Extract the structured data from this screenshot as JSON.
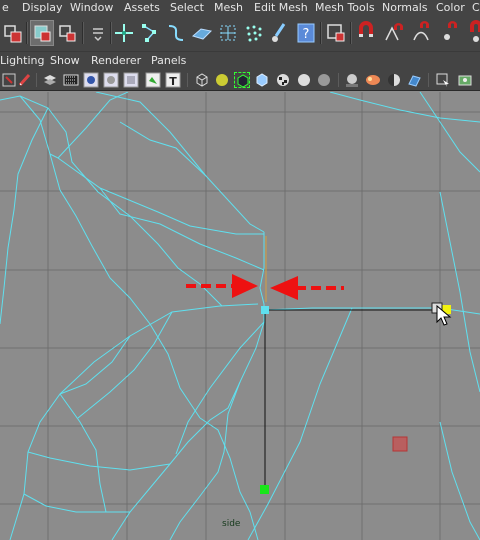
{
  "menubar": {
    "items": [
      "e",
      "Display",
      "Window",
      "Assets",
      "Select",
      "Mesh",
      "Edit Mesh",
      "Mesh Tools",
      "Normals",
      "Color",
      "C"
    ]
  },
  "shelf": {
    "icons": [
      "select-tool-icon",
      "lasso-tool-icon",
      "paint-select-icon",
      "hypershade-icon",
      "move-tool-icon",
      "vertex-select-icon",
      "curve-tool-icon",
      "face-select-icon",
      "uv-select-icon",
      "soft-select-icon",
      "paint-effects-icon",
      "help-icon",
      "select-component-icon",
      "magnet-snap-icon",
      "snap-curve-icon",
      "snap-point-icon",
      "snap-view-icon"
    ]
  },
  "panel_menu": {
    "items": [
      "Lighting",
      "Show",
      "Renderer",
      "Panels"
    ]
  },
  "panel_toolbar": {
    "icons": [
      "camera-attributes-icon",
      "film-gate-icon",
      "resolution-gate-icon",
      "gate-mask-icon",
      "field-chart-icon",
      "safe-action-icon",
      "grid-icon",
      "wireframe-icon",
      "isolate-select-icon",
      "xray-icon",
      "shaded-icon",
      "textured-icon",
      "smooth-shade-icon",
      "lights-icon",
      "shadows-icon",
      "ambient-occlusion-icon",
      "motion-blur-icon",
      "hud-icon",
      "isolate-icon",
      "display-select-icon"
    ]
  },
  "viewport": {
    "camera_label": "side",
    "colors": {
      "background": "#8c8c8c",
      "grid": "#6f6f6f",
      "wireframe": "#5fe0ef",
      "arrow": "#ee1111",
      "selected_vertex": "#5fe0ef",
      "green_marker": "#19e619",
      "yellow_marker": "#f2f20f",
      "red_marker": "#cc4b4b"
    }
  }
}
